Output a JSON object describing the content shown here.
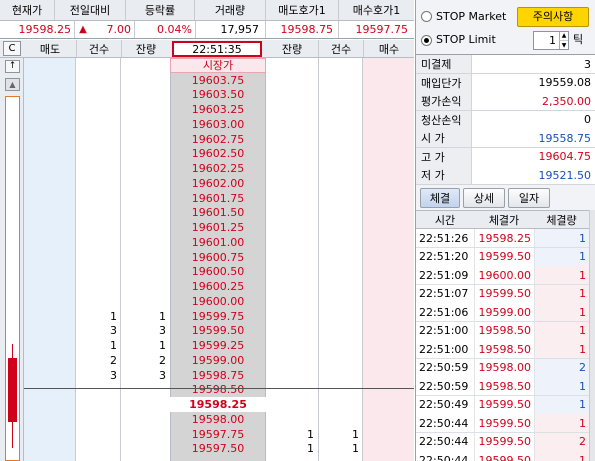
{
  "summary": {
    "headers": [
      "현재가",
      "전일대비",
      "등락률",
      "거래량",
      "매도호가1",
      "매수호가1"
    ],
    "current_price": "19598.25",
    "change_arrow": "▲",
    "change": "7.00",
    "change_rate": "0.04%",
    "volume": "17,957",
    "ask1": "19598.75",
    "bid1": "19597.75"
  },
  "ladder": {
    "corner_label": "C",
    "headers": {
      "sell": "매도",
      "count": "건수",
      "remain": "잔량",
      "clock": "22:51:35",
      "remain2": "잔량",
      "count2": "건수",
      "buy": "매수"
    },
    "market_label": "시장가",
    "rows": [
      {
        "price": "19603.75",
        "sc": "",
        "sr": "",
        "bc": "",
        "br": ""
      },
      {
        "price": "19603.50",
        "sc": "",
        "sr": "",
        "bc": "",
        "br": ""
      },
      {
        "price": "19603.25",
        "sc": "",
        "sr": "",
        "bc": "",
        "br": ""
      },
      {
        "price": "19603.00",
        "sc": "",
        "sr": "",
        "bc": "",
        "br": ""
      },
      {
        "price": "19602.75",
        "sc": "",
        "sr": "",
        "bc": "",
        "br": ""
      },
      {
        "price": "19602.50",
        "sc": "",
        "sr": "",
        "bc": "",
        "br": ""
      },
      {
        "price": "19602.25",
        "sc": "",
        "sr": "",
        "bc": "",
        "br": ""
      },
      {
        "price": "19602.00",
        "sc": "",
        "sr": "",
        "bc": "",
        "br": ""
      },
      {
        "price": "19601.75",
        "sc": "",
        "sr": "",
        "bc": "",
        "br": ""
      },
      {
        "price": "19601.50",
        "sc": "",
        "sr": "",
        "bc": "",
        "br": ""
      },
      {
        "price": "19601.25",
        "sc": "",
        "sr": "",
        "bc": "",
        "br": ""
      },
      {
        "price": "19601.00",
        "sc": "",
        "sr": "",
        "bc": "",
        "br": ""
      },
      {
        "price": "19600.75",
        "sc": "",
        "sr": "",
        "bc": "",
        "br": ""
      },
      {
        "price": "19600.50",
        "sc": "",
        "sr": "",
        "bc": "",
        "br": ""
      },
      {
        "price": "19600.25",
        "sc": "",
        "sr": "",
        "bc": "",
        "br": ""
      },
      {
        "price": "19600.00",
        "sc": "",
        "sr": "",
        "bc": "",
        "br": ""
      },
      {
        "price": "19599.75",
        "sc": "1",
        "sr": "1",
        "bc": "",
        "br": ""
      },
      {
        "price": "19599.50",
        "sc": "3",
        "sr": "3",
        "bc": "",
        "br": ""
      },
      {
        "price": "19599.25",
        "sc": "1",
        "sr": "1",
        "bc": "",
        "br": ""
      },
      {
        "price": "19599.00",
        "sc": "2",
        "sr": "2",
        "bc": "",
        "br": ""
      },
      {
        "price": "19598.75",
        "sc": "3",
        "sr": "3",
        "bc": "",
        "br": ""
      },
      {
        "price": "19598.50",
        "sc": "",
        "sr": "",
        "bc": "",
        "br": ""
      },
      {
        "price": "19598.25",
        "sc": "",
        "sr": "",
        "bc": "",
        "br": "",
        "current": true
      },
      {
        "price": "19598.00",
        "sc": "",
        "sr": "",
        "bc": "",
        "br": ""
      },
      {
        "price": "19597.75",
        "sc": "",
        "sr": "",
        "bc": "1",
        "br": "1"
      },
      {
        "price": "19597.50",
        "sc": "",
        "sr": "",
        "bc": "1",
        "br": "1"
      }
    ]
  },
  "panel": {
    "stop_market_label": "STOP Market",
    "stop_limit_label": "STOP Limit",
    "notice_button": "주의사항",
    "tick_value": "1",
    "tick_unit": "틱",
    "stats": [
      {
        "label": "미결제",
        "value": "3",
        "color": "black"
      },
      {
        "label": "매입단가",
        "value": "19559.08",
        "color": "black"
      },
      {
        "label": "평가손익",
        "value": "2,350.00",
        "color": "red"
      },
      {
        "label": "청산손익",
        "value": "0",
        "color": "black"
      },
      {
        "label": "시 가",
        "value": "19558.75",
        "color": "blue"
      },
      {
        "label": "고 가",
        "value": "19604.75",
        "color": "red"
      },
      {
        "label": "저 가",
        "value": "19521.50",
        "color": "blue"
      }
    ],
    "tabs": [
      "체결",
      "상세",
      "일자"
    ],
    "trade_headers": [
      "시간",
      "체결가",
      "체결량"
    ],
    "trades": [
      {
        "time": "22:51:26",
        "price": "19598.25",
        "qty": "1",
        "side": "buy"
      },
      {
        "time": "22:51:20",
        "price": "19599.50",
        "qty": "1",
        "side": "buy"
      },
      {
        "time": "22:51:09",
        "price": "19600.00",
        "qty": "1",
        "side": "sell"
      },
      {
        "time": "22:51:07",
        "price": "19599.50",
        "qty": "1",
        "side": "sell"
      },
      {
        "time": "22:51:06",
        "price": "19599.00",
        "qty": "1",
        "side": "sell"
      },
      {
        "time": "22:51:00",
        "price": "19598.50",
        "qty": "1",
        "side": "sell"
      },
      {
        "time": "22:51:00",
        "price": "19598.50",
        "qty": "1",
        "side": "sell"
      },
      {
        "time": "22:50:59",
        "price": "19598.00",
        "qty": "2",
        "side": "buy"
      },
      {
        "time": "22:50:59",
        "price": "19598.50",
        "qty": "1",
        "side": "buy"
      },
      {
        "time": "22:50:49",
        "price": "19599.50",
        "qty": "1",
        "side": "buy"
      },
      {
        "time": "22:50:44",
        "price": "19599.50",
        "qty": "1",
        "side": "sell"
      },
      {
        "time": "22:50:44",
        "price": "19599.50",
        "qty": "2",
        "side": "sell"
      },
      {
        "time": "22:50:44",
        "price": "19599.50",
        "qty": "1",
        "side": "sell"
      }
    ]
  }
}
